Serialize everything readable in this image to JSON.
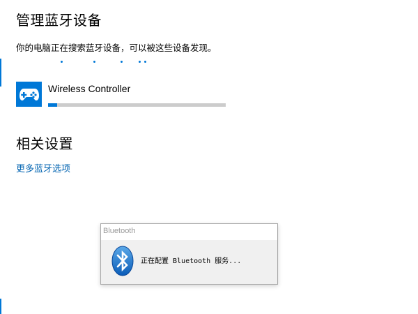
{
  "manage_section": {
    "title": "管理蓝牙设备",
    "discovery_text": "你的电脑正在搜索蓝牙设备，可以被这些设备发现。"
  },
  "device": {
    "name": "Wireless Controller",
    "icon": "gamepad-icon",
    "pairing_progress": 0.05
  },
  "related_section": {
    "title": "相关设置",
    "link": "更多蓝牙选项"
  },
  "dialog": {
    "title": "Bluetooth",
    "icon": "bluetooth-icon",
    "message": "正在配置 Bluetooth 服务..."
  },
  "colors": {
    "accent": "#0078d7",
    "link": "#0063b1",
    "track": "#cccccc"
  }
}
